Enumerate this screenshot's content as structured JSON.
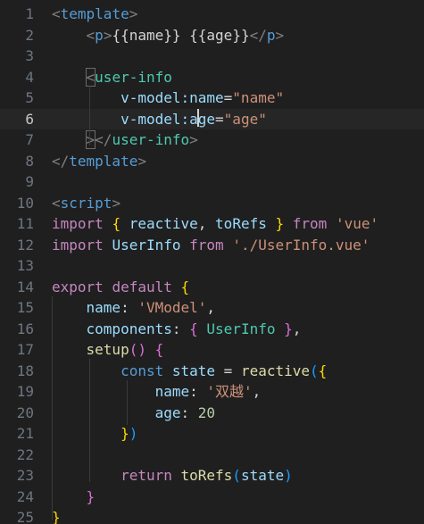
{
  "editor": {
    "active_line": 6,
    "lines": [
      {
        "n": "1",
        "tokens": [
          [
            "t-punc",
            "<"
          ],
          [
            "t-tag",
            "template"
          ],
          [
            "t-punc",
            ">"
          ]
        ]
      },
      {
        "n": "2",
        "tokens": [
          [
            "t-plain",
            "    "
          ],
          [
            "t-punc",
            "<"
          ],
          [
            "t-tag",
            "p"
          ],
          [
            "t-punc",
            ">"
          ],
          [
            "t-text",
            "{{name}} {{age}}"
          ],
          [
            "t-punc",
            "</"
          ],
          [
            "t-tag",
            "p"
          ],
          [
            "t-punc",
            ">"
          ]
        ]
      },
      {
        "n": "3",
        "tokens": []
      },
      {
        "n": "4",
        "tokens": [
          [
            "t-plain",
            "    "
          ],
          [
            "t-punc matchbox",
            "<"
          ],
          [
            "t-cls",
            "user-info"
          ]
        ]
      },
      {
        "n": "5",
        "tokens": [
          [
            "t-plain",
            "        "
          ],
          [
            "t-attr",
            "v-model:name"
          ],
          [
            "t-plain",
            "="
          ],
          [
            "t-str",
            "\"name\""
          ]
        ]
      },
      {
        "n": "6",
        "tokens": [
          [
            "t-plain",
            "        "
          ],
          [
            "t-attr",
            "v-model:age"
          ],
          [
            "t-plain",
            "="
          ],
          [
            "t-str",
            "\"age\""
          ]
        ]
      },
      {
        "n": "7",
        "tokens": [
          [
            "t-plain",
            "    "
          ],
          [
            "t-punc matchbox",
            ">"
          ],
          [
            "t-punc",
            "</"
          ],
          [
            "t-cls",
            "user-info"
          ],
          [
            "t-punc",
            ">"
          ]
        ]
      },
      {
        "n": "8",
        "tokens": [
          [
            "t-punc",
            "</"
          ],
          [
            "t-tag",
            "template"
          ],
          [
            "t-punc",
            ">"
          ]
        ]
      },
      {
        "n": "9",
        "tokens": []
      },
      {
        "n": "10",
        "tokens": [
          [
            "t-punc",
            "<"
          ],
          [
            "t-tag",
            "script"
          ],
          [
            "t-punc",
            ">"
          ]
        ]
      },
      {
        "n": "11",
        "tokens": [
          [
            "t-kw",
            "import"
          ],
          [
            "t-plain",
            " "
          ],
          [
            "t-br",
            "{"
          ],
          [
            "t-plain",
            " "
          ],
          [
            "t-var",
            "reactive"
          ],
          [
            "t-plain",
            ", "
          ],
          [
            "t-var",
            "toRefs"
          ],
          [
            "t-plain",
            " "
          ],
          [
            "t-br",
            "}"
          ],
          [
            "t-plain",
            " "
          ],
          [
            "t-kw",
            "from"
          ],
          [
            "t-plain",
            " "
          ],
          [
            "t-str",
            "'vue'"
          ]
        ]
      },
      {
        "n": "12",
        "tokens": [
          [
            "t-kw",
            "import"
          ],
          [
            "t-plain",
            " "
          ],
          [
            "t-var",
            "UserInfo"
          ],
          [
            "t-plain",
            " "
          ],
          [
            "t-kw",
            "from"
          ],
          [
            "t-plain",
            " "
          ],
          [
            "t-str",
            "'./UserInfo.vue'"
          ]
        ]
      },
      {
        "n": "13",
        "tokens": []
      },
      {
        "n": "14",
        "tokens": [
          [
            "t-kw",
            "export"
          ],
          [
            "t-plain",
            " "
          ],
          [
            "t-kw",
            "default"
          ],
          [
            "t-plain",
            " "
          ],
          [
            "t-br",
            "{"
          ]
        ]
      },
      {
        "n": "15",
        "tokens": [
          [
            "t-plain",
            "    "
          ],
          [
            "t-var",
            "name"
          ],
          [
            "t-plain",
            ": "
          ],
          [
            "t-str",
            "'VModel'"
          ],
          [
            "t-plain",
            ","
          ]
        ]
      },
      {
        "n": "16",
        "tokens": [
          [
            "t-plain",
            "    "
          ],
          [
            "t-var",
            "components"
          ],
          [
            "t-plain",
            ": "
          ],
          [
            "t-br2",
            "{"
          ],
          [
            "t-plain",
            " "
          ],
          [
            "t-cls",
            "UserInfo"
          ],
          [
            "t-plain",
            " "
          ],
          [
            "t-br2",
            "}"
          ],
          [
            "t-plain",
            ","
          ]
        ]
      },
      {
        "n": "17",
        "tokens": [
          [
            "t-plain",
            "    "
          ],
          [
            "t-fn",
            "setup"
          ],
          [
            "t-br2",
            "()"
          ],
          [
            "t-plain",
            " "
          ],
          [
            "t-br2",
            "{"
          ]
        ]
      },
      {
        "n": "18",
        "tokens": [
          [
            "t-plain",
            "        "
          ],
          [
            "t-decl",
            "const"
          ],
          [
            "t-plain",
            " "
          ],
          [
            "t-var",
            "state"
          ],
          [
            "t-plain",
            " = "
          ],
          [
            "t-fn",
            "reactive"
          ],
          [
            "t-br3",
            "("
          ],
          [
            "t-br",
            "{"
          ]
        ]
      },
      {
        "n": "19",
        "tokens": [
          [
            "t-plain",
            "            "
          ],
          [
            "t-var",
            "name"
          ],
          [
            "t-plain",
            ": "
          ],
          [
            "t-str",
            "'双越'"
          ],
          [
            "t-plain",
            ","
          ]
        ]
      },
      {
        "n": "20",
        "tokens": [
          [
            "t-plain",
            "            "
          ],
          [
            "t-var",
            "age"
          ],
          [
            "t-plain",
            ": "
          ],
          [
            "t-num",
            "20"
          ]
        ]
      },
      {
        "n": "21",
        "tokens": [
          [
            "t-plain",
            "        "
          ],
          [
            "t-br",
            "}"
          ],
          [
            "t-br3",
            ")"
          ]
        ]
      },
      {
        "n": "22",
        "tokens": []
      },
      {
        "n": "23",
        "tokens": [
          [
            "t-plain",
            "        "
          ],
          [
            "t-kw",
            "return"
          ],
          [
            "t-plain",
            " "
          ],
          [
            "t-fn",
            "toRefs"
          ],
          [
            "t-br3",
            "("
          ],
          [
            "t-var",
            "state"
          ],
          [
            "t-br3",
            ")"
          ]
        ]
      },
      {
        "n": "24",
        "tokens": [
          [
            "t-plain",
            "    "
          ],
          [
            "t-br2",
            "}"
          ]
        ]
      },
      {
        "n": "25",
        "tokens": [
          [
            "t-br",
            "}"
          ]
        ]
      }
    ]
  }
}
